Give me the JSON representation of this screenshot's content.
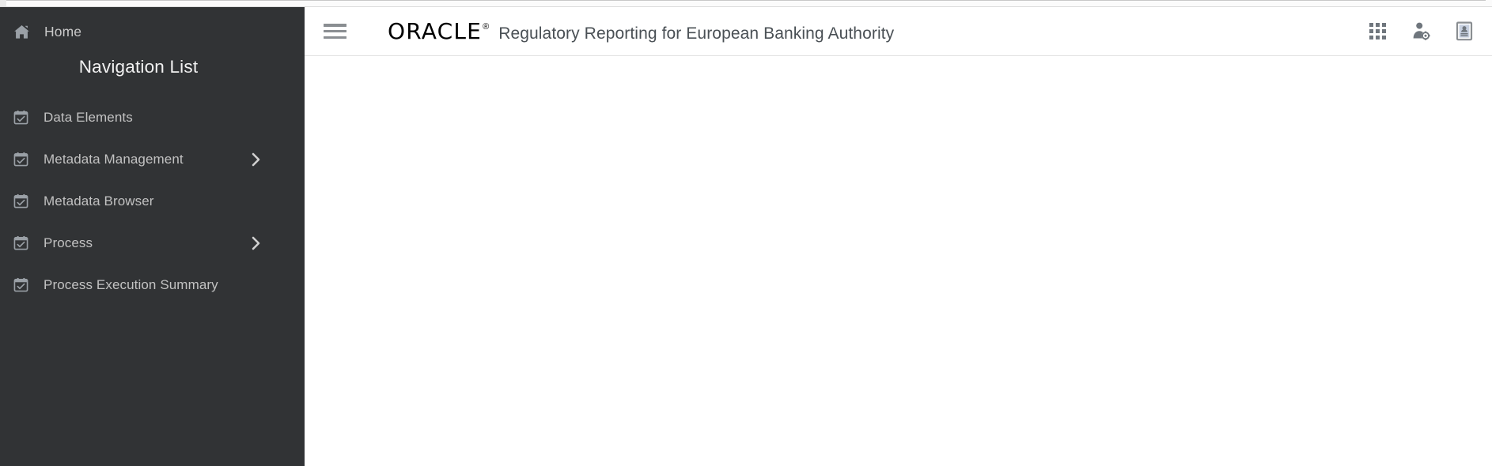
{
  "window": {
    "chrome_visible": true
  },
  "theme": {
    "sidebar_bg": "#313335",
    "sidebar_text": "#c2c2c2",
    "sidebar_title_text": "#f2f2f2",
    "header_bg": "#ffffff",
    "header_title_text": "#4a5055",
    "icon_gray": "#6f767d",
    "content_bg": "#ffffff"
  },
  "sidebar": {
    "home": {
      "label": "Home",
      "icon": "home-icon"
    },
    "title": "Navigation List",
    "items": [
      {
        "label": "Data Elements",
        "icon": "calendar-check-icon",
        "has_submenu": false
      },
      {
        "label": "Metadata Management",
        "icon": "calendar-check-icon",
        "has_submenu": true,
        "chevron": "chevron-right-icon"
      },
      {
        "label": "Metadata Browser",
        "icon": "calendar-check-icon",
        "has_submenu": false
      },
      {
        "label": "Process",
        "icon": "calendar-check-icon",
        "has_submenu": true,
        "chevron": "chevron-right-icon"
      },
      {
        "label": "Process Execution Summary",
        "icon": "calendar-check-icon",
        "has_submenu": false
      }
    ]
  },
  "header": {
    "menu_toggle": {
      "icon": "hamburger-menu-icon",
      "label": "Menu"
    },
    "brand": {
      "name": "ORACLE",
      "trademark": "®"
    },
    "app_title": "Regulatory Reporting for European Banking Authority",
    "icons": [
      {
        "name": "apps-grid-icon",
        "label": "Applications"
      },
      {
        "name": "user-settings-icon",
        "label": "User Settings"
      },
      {
        "name": "id-badge-icon",
        "label": "Profile Card"
      }
    ]
  },
  "main": {
    "body_text": ""
  }
}
